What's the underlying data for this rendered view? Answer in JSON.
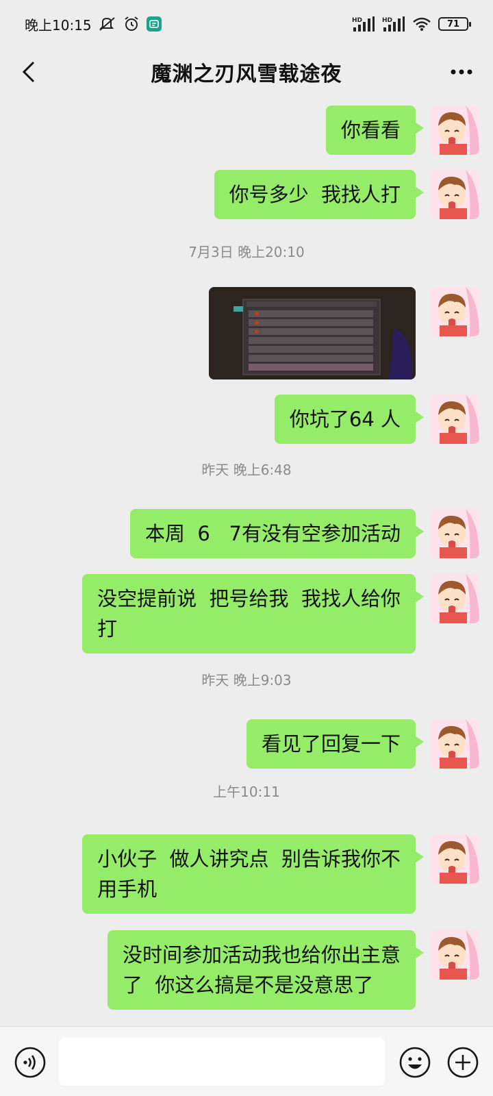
{
  "status_bar": {
    "time": "晚上10:15",
    "battery": "71",
    "signal1": "HD",
    "signal2": "HD"
  },
  "header": {
    "title": "魔渊之刃风雪载途夜"
  },
  "messages": [
    {
      "type": "text",
      "text": "你看看"
    },
    {
      "type": "text",
      "text": "你号多少  我找人打"
    },
    {
      "type": "time",
      "text": "7月3日 晚上20:10"
    },
    {
      "type": "image"
    },
    {
      "type": "text",
      "text": "你坑了64 人"
    },
    {
      "type": "time",
      "text": "昨天 晚上6:48"
    },
    {
      "type": "text",
      "text": "本周  6   7有没有空参加活动"
    },
    {
      "type": "text",
      "text": "没空提前说  把号给我  我找人给你\n打"
    },
    {
      "type": "time",
      "text": "昨天 晚上9:03"
    },
    {
      "type": "text",
      "text": "看见了回复一下"
    },
    {
      "type": "time",
      "text": "上午10:11"
    },
    {
      "type": "text",
      "text": "小伙子  做人讲究点  别告诉我你不\n用手机"
    },
    {
      "type": "text",
      "text": "没时间参加活动我也给你出主意\n了  你这么搞是不是没意思了"
    }
  ],
  "icons": {
    "back": "chevron-left-icon",
    "more": "more-dots-icon",
    "voice": "voice-icon",
    "emoji": "emoji-icon",
    "plus": "plus-icon"
  },
  "colors": {
    "bubble_self": "#95ec69",
    "background": "#ededed",
    "timestamp": "#8a8a8a"
  }
}
